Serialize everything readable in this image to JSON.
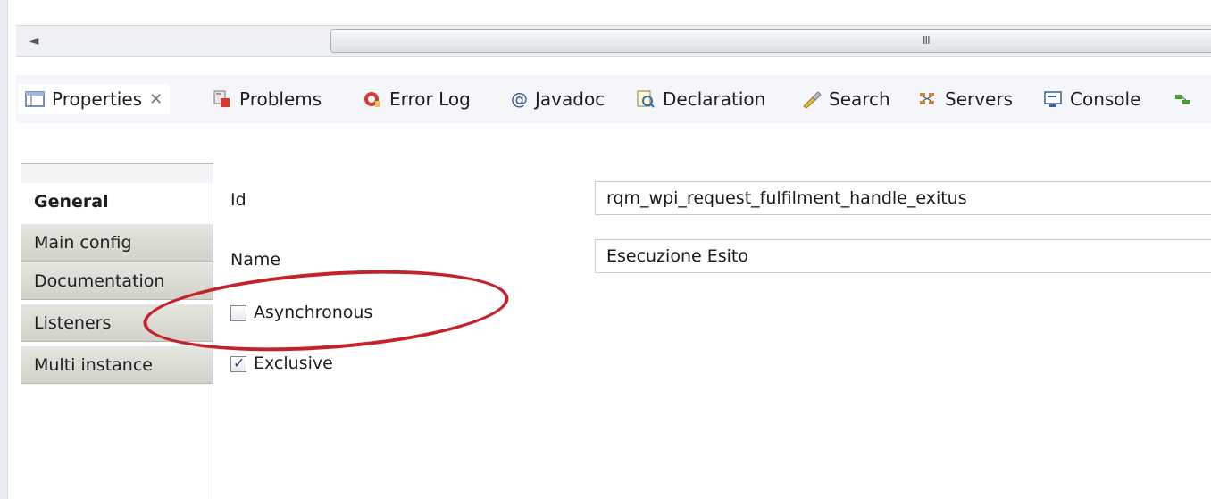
{
  "scrollbar": {
    "left_arrow": "◄",
    "grip": "III"
  },
  "tabs": [
    {
      "label": "Properties",
      "icon": "properties-view-icon",
      "active": true
    },
    {
      "label": "Problems",
      "icon": "problems-icon"
    },
    {
      "label": "Error Log",
      "icon": "error-log-icon"
    },
    {
      "label": "Javadoc",
      "icon": "javadoc-at-icon"
    },
    {
      "label": "Declaration",
      "icon": "declaration-icon"
    },
    {
      "label": "Search",
      "icon": "search-flashlight-icon"
    },
    {
      "label": "Servers",
      "icon": "servers-icon"
    },
    {
      "label": "Console",
      "icon": "console-icon"
    }
  ],
  "tab_close": "✕",
  "javadoc_at": "@",
  "categories": [
    "General",
    "Main config",
    "Documentation",
    "Listeners",
    "Multi instance"
  ],
  "form": {
    "id_label": "Id",
    "id_value": "rqm_wpi_request_fulfilment_handle_exitus",
    "name_label": "Name",
    "name_value": "Esecuzione Esito",
    "asynchronous_label": "Asynchronous",
    "asynchronous_checked": false,
    "exclusive_label": "Exclusive",
    "exclusive_checked": true
  },
  "colors": {
    "annotation_circle": "#c4212a",
    "error_icon": "#d9382b"
  }
}
